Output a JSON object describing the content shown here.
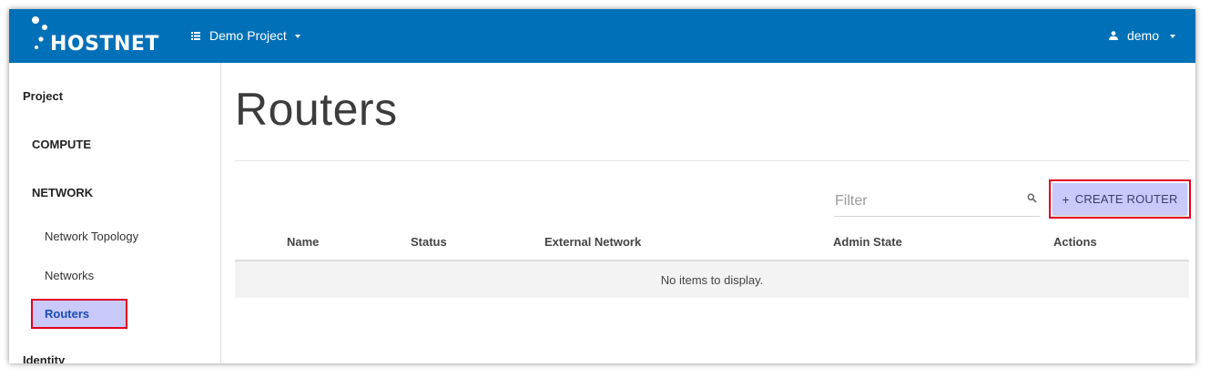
{
  "header": {
    "brand": "HOSTNET",
    "project_label": "Demo Project",
    "user_label": "demo"
  },
  "sidebar": {
    "project": "Project",
    "compute": "COMPUTE",
    "network": "NETWORK",
    "links": [
      "Network Topology",
      "Networks",
      "Routers"
    ],
    "identity": "Identity"
  },
  "main": {
    "title": "Routers",
    "filter_placeholder": "Filter",
    "create_label": "CREATE ROUTER",
    "columns": [
      "Name",
      "Status",
      "External Network",
      "Admin State",
      "Actions"
    ],
    "empty_message": "No items to display."
  },
  "colors": {
    "header_bg": "#0070b8",
    "highlight_fill": "#c9c9fb",
    "highlight_border": "#e3001b",
    "active_text": "#1a4cb8"
  },
  "icons": [
    "hostnet-logo-icon",
    "list-icon",
    "chevron-down-icon",
    "person-icon",
    "search-icon",
    "plus-icon"
  ]
}
